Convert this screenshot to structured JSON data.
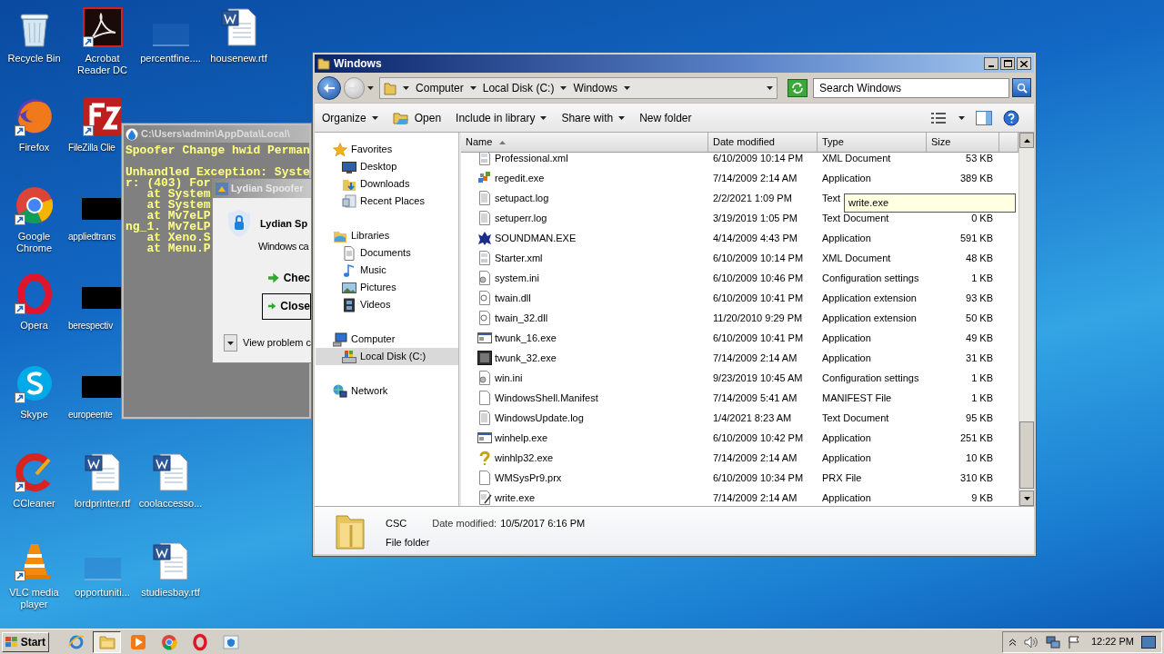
{
  "desktop": {
    "columns": [
      [
        {
          "kind": "recycle",
          "label": "Recycle Bin",
          "shortcut": false,
          "cut": false
        },
        {
          "kind": "firefox",
          "label": "Firefox",
          "shortcut": true,
          "cut": false
        },
        {
          "kind": "chrome",
          "label": "Google Chrome",
          "shortcut": true,
          "cut": false
        },
        {
          "kind": "opera",
          "label": "Opera",
          "shortcut": true,
          "cut": false
        },
        {
          "kind": "skype",
          "label": "Skype",
          "shortcut": true,
          "cut": false
        },
        {
          "kind": "ccleaner",
          "label": "CCleaner",
          "shortcut": true,
          "cut": false
        },
        {
          "kind": "vlc",
          "label": "VLC media player",
          "shortcut": true,
          "cut": false
        }
      ],
      [
        {
          "kind": "pdf",
          "label": "Acrobat Reader DC",
          "shortcut": true,
          "cut": false
        },
        {
          "kind": "filezilla",
          "label": "FileZilla Clie",
          "shortcut": true,
          "cut": true
        },
        {
          "kind": "redacted",
          "label": "appliedtrans",
          "shortcut": false,
          "cut": true
        },
        {
          "kind": "redacted",
          "label": "berespectiv",
          "shortcut": false,
          "cut": true
        },
        {
          "kind": "redacted",
          "label": "europeente",
          "shortcut": false,
          "cut": true
        },
        {
          "kind": "word",
          "label": "lordprinter.rtf",
          "shortcut": false,
          "cut": false
        },
        {
          "kind": "blank",
          "label": "opportuniti...",
          "shortcut": false,
          "cut": false
        }
      ],
      [
        {
          "kind": "blank",
          "label": "percentfine....",
          "shortcut": false,
          "cut": false
        },
        {
          "kind": "empty"
        },
        {
          "kind": "empty"
        },
        {
          "kind": "empty"
        },
        {
          "kind": "empty"
        },
        {
          "kind": "word",
          "label": "coolaccesso...",
          "shortcut": false,
          "cut": false
        },
        {
          "kind": "word",
          "label": "studiesbay.rtf",
          "shortcut": false,
          "cut": false
        }
      ],
      [
        {
          "kind": "word",
          "label": "housenew.rtf",
          "shortcut": false,
          "cut": false
        }
      ]
    ]
  },
  "console": {
    "title": "C:\\Users\\admin\\AppData\\Local\\",
    "blocks": [
      [
        "Spoofer Change hwid Perman"
      ],
      [
        "Unhandled Exception: Syste",
        "r: (403) For",
        "   at System",
        "   at System",
        "   at Mv7eLP",
        "ng_1. Mv7eLP",
        "   at Xeno.S",
        "   at Menu.P"
      ]
    ]
  },
  "dialog": {
    "title": "Lydian Spoofer",
    "heading": "Lydian Sp",
    "message": "Windows ca",
    "options": [
      {
        "label": "Chec",
        "focused": false
      },
      {
        "label": "Close",
        "focused": true
      }
    ],
    "details_toggle": "View problem c"
  },
  "explorer": {
    "title": "Windows",
    "breadcrumbs": [
      "Computer",
      "Local Disk (C:)",
      "Windows"
    ],
    "search": {
      "placeholder": "Search Windows"
    },
    "toolbar": [
      {
        "label": "Organize",
        "kind": "menu"
      },
      {
        "label": "Open",
        "kind": "open"
      },
      {
        "label": "Include in library",
        "kind": "menu"
      },
      {
        "label": "Share with",
        "kind": "menu"
      },
      {
        "label": "New folder",
        "kind": "plain"
      }
    ],
    "nav": [
      {
        "label": "Favorites",
        "kind": "favorites",
        "selected": false,
        "children": [
          {
            "label": "Desktop",
            "kind": "desktop",
            "selected": false
          },
          {
            "label": "Downloads",
            "kind": "downloads",
            "selected": false
          },
          {
            "label": "Recent Places",
            "kind": "recent",
            "selected": false
          }
        ]
      },
      {
        "label": "Libraries",
        "kind": "libraries",
        "selected": false,
        "children": [
          {
            "label": "Documents",
            "kind": "documents",
            "selected": false
          },
          {
            "label": "Music",
            "kind": "music",
            "selected": false
          },
          {
            "label": "Pictures",
            "kind": "pictures",
            "selected": false
          },
          {
            "label": "Videos",
            "kind": "videos",
            "selected": false
          }
        ]
      },
      {
        "label": "Computer",
        "kind": "computer",
        "selected": false,
        "children": [
          {
            "label": "Local Disk (C:)",
            "kind": "drive",
            "selected": true
          }
        ]
      },
      {
        "label": "Network",
        "kind": "network",
        "selected": false
      }
    ],
    "columns": [
      "Name",
      "Date modified",
      "Type",
      "Size"
    ],
    "rows": [
      {
        "kind": "xml",
        "name": "Professional.xml",
        "date": "6/10/2009 10:14 PM",
        "type": "XML Document",
        "size": "53 KB"
      },
      {
        "kind": "regedit",
        "name": "regedit.exe",
        "date": "7/14/2009 2:14 AM",
        "type": "Application",
        "size": "389 KB"
      },
      {
        "kind": "text",
        "name": "setupact.log",
        "date": "2/2/2021 1:09 PM",
        "type": "Text"
      },
      {
        "kind": "text",
        "name": "setuperr.log",
        "date": "3/19/2019 1:05 PM",
        "type": "Text Document",
        "size": "0 KB"
      },
      {
        "kind": "sound",
        "name": "SOUNDMAN.EXE",
        "date": "4/14/2009 4:43 PM",
        "type": "Application",
        "size": "591 KB"
      },
      {
        "kind": "xml",
        "name": "Starter.xml",
        "date": "6/10/2009 10:14 PM",
        "type": "XML Document",
        "size": "48 KB"
      },
      {
        "kind": "config",
        "name": "system.ini",
        "date": "6/10/2009 10:46 PM",
        "type": "Configuration settings",
        "size": "1 KB"
      },
      {
        "kind": "dll",
        "name": "twain.dll",
        "date": "6/10/2009 10:41 PM",
        "type": "Application extension",
        "size": "93 KB"
      },
      {
        "kind": "dll",
        "name": "twain_32.dll",
        "date": "11/20/2010 9:29 PM",
        "type": "Application extension",
        "size": "50 KB"
      },
      {
        "kind": "app",
        "name": "twunk_16.exe",
        "date": "6/10/2009 10:41 PM",
        "type": "Application",
        "size": "49 KB"
      },
      {
        "kind": "darkapp",
        "name": "twunk_32.exe",
        "date": "7/14/2009 2:14 AM",
        "type": "Application",
        "size": "31 KB"
      },
      {
        "kind": "config",
        "name": "win.ini",
        "date": "9/23/2019 10:45 AM",
        "type": "Configuration settings",
        "size": "1 KB"
      },
      {
        "kind": "blank",
        "name": "WindowsShell.Manifest",
        "date": "7/14/2009 5:41 AM",
        "type": "MANIFEST File",
        "size": "1 KB"
      },
      {
        "kind": "text",
        "name": "WindowsUpdate.log",
        "date": "1/4/2021 8:23 AM",
        "type": "Text Document",
        "size": "95 KB"
      },
      {
        "kind": "app",
        "name": "winhelp.exe",
        "date": "6/10/2009 10:42 PM",
        "type": "Application",
        "size": "251 KB"
      },
      {
        "kind": "help",
        "name": "winhlp32.exe",
        "date": "7/14/2009 2:14 AM",
        "type": "Application",
        "size": "10 KB"
      },
      {
        "kind": "blank",
        "name": "WMSysPr9.prx",
        "date": "6/10/2009 10:34 PM",
        "type": "PRX File",
        "size": "310 KB"
      },
      {
        "kind": "write",
        "name": "write.exe",
        "date": "7/14/2009 2:14 AM",
        "type": "Application",
        "size": "9 KB"
      }
    ],
    "tooltip": "write.exe",
    "details": {
      "name": "CSC",
      "date_label": "Date modified:",
      "date": "10/5/2017 6:16 PM",
      "type": "File folder"
    }
  },
  "taskbar": {
    "start": "Start",
    "apps": [
      {
        "kind": "ie",
        "selected": false
      },
      {
        "kind": "folder",
        "selected": true
      },
      {
        "kind": "media",
        "selected": false
      },
      {
        "kind": "chrome",
        "selected": false
      },
      {
        "kind": "opera",
        "selected": false
      },
      {
        "kind": "spoofer",
        "selected": false
      }
    ],
    "clock": "12:22 PM"
  }
}
